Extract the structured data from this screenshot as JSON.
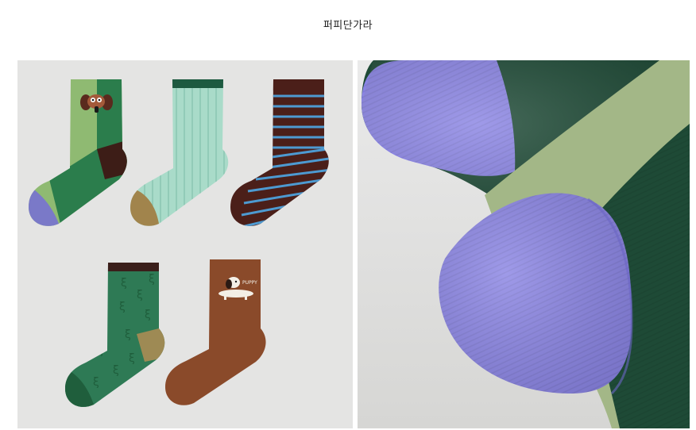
{
  "header": {
    "title": "퍼피단가라"
  },
  "product_image": {
    "sock_count": 5,
    "socks": [
      {
        "pattern": "color-block with dog face",
        "colors": [
          "#8fba72",
          "#2b7d4c",
          "#3d1d17",
          "#7a79c8"
        ]
      },
      {
        "pattern": "vertical pinstripe",
        "colors": [
          "#a9dbc9",
          "#1d5a40",
          "#a1844c"
        ]
      },
      {
        "pattern": "horizontal stripes",
        "colors": [
          "#4b1f19",
          "#4d9ad1"
        ]
      },
      {
        "pattern": "green with small marks",
        "colors": [
          "#2e7a55",
          "#3a1e1a",
          "#9e8a54",
          "#1f5e3c"
        ]
      },
      {
        "pattern": "brown with dachshund",
        "label": "PUPPY",
        "colors": [
          "#8a4a2a",
          "#f3efe6"
        ]
      }
    ]
  },
  "detail_image": {
    "subject": "close-up of sock toes",
    "colors": [
      "#8a84e4",
      "#1e4a36",
      "#a3b787"
    ]
  }
}
